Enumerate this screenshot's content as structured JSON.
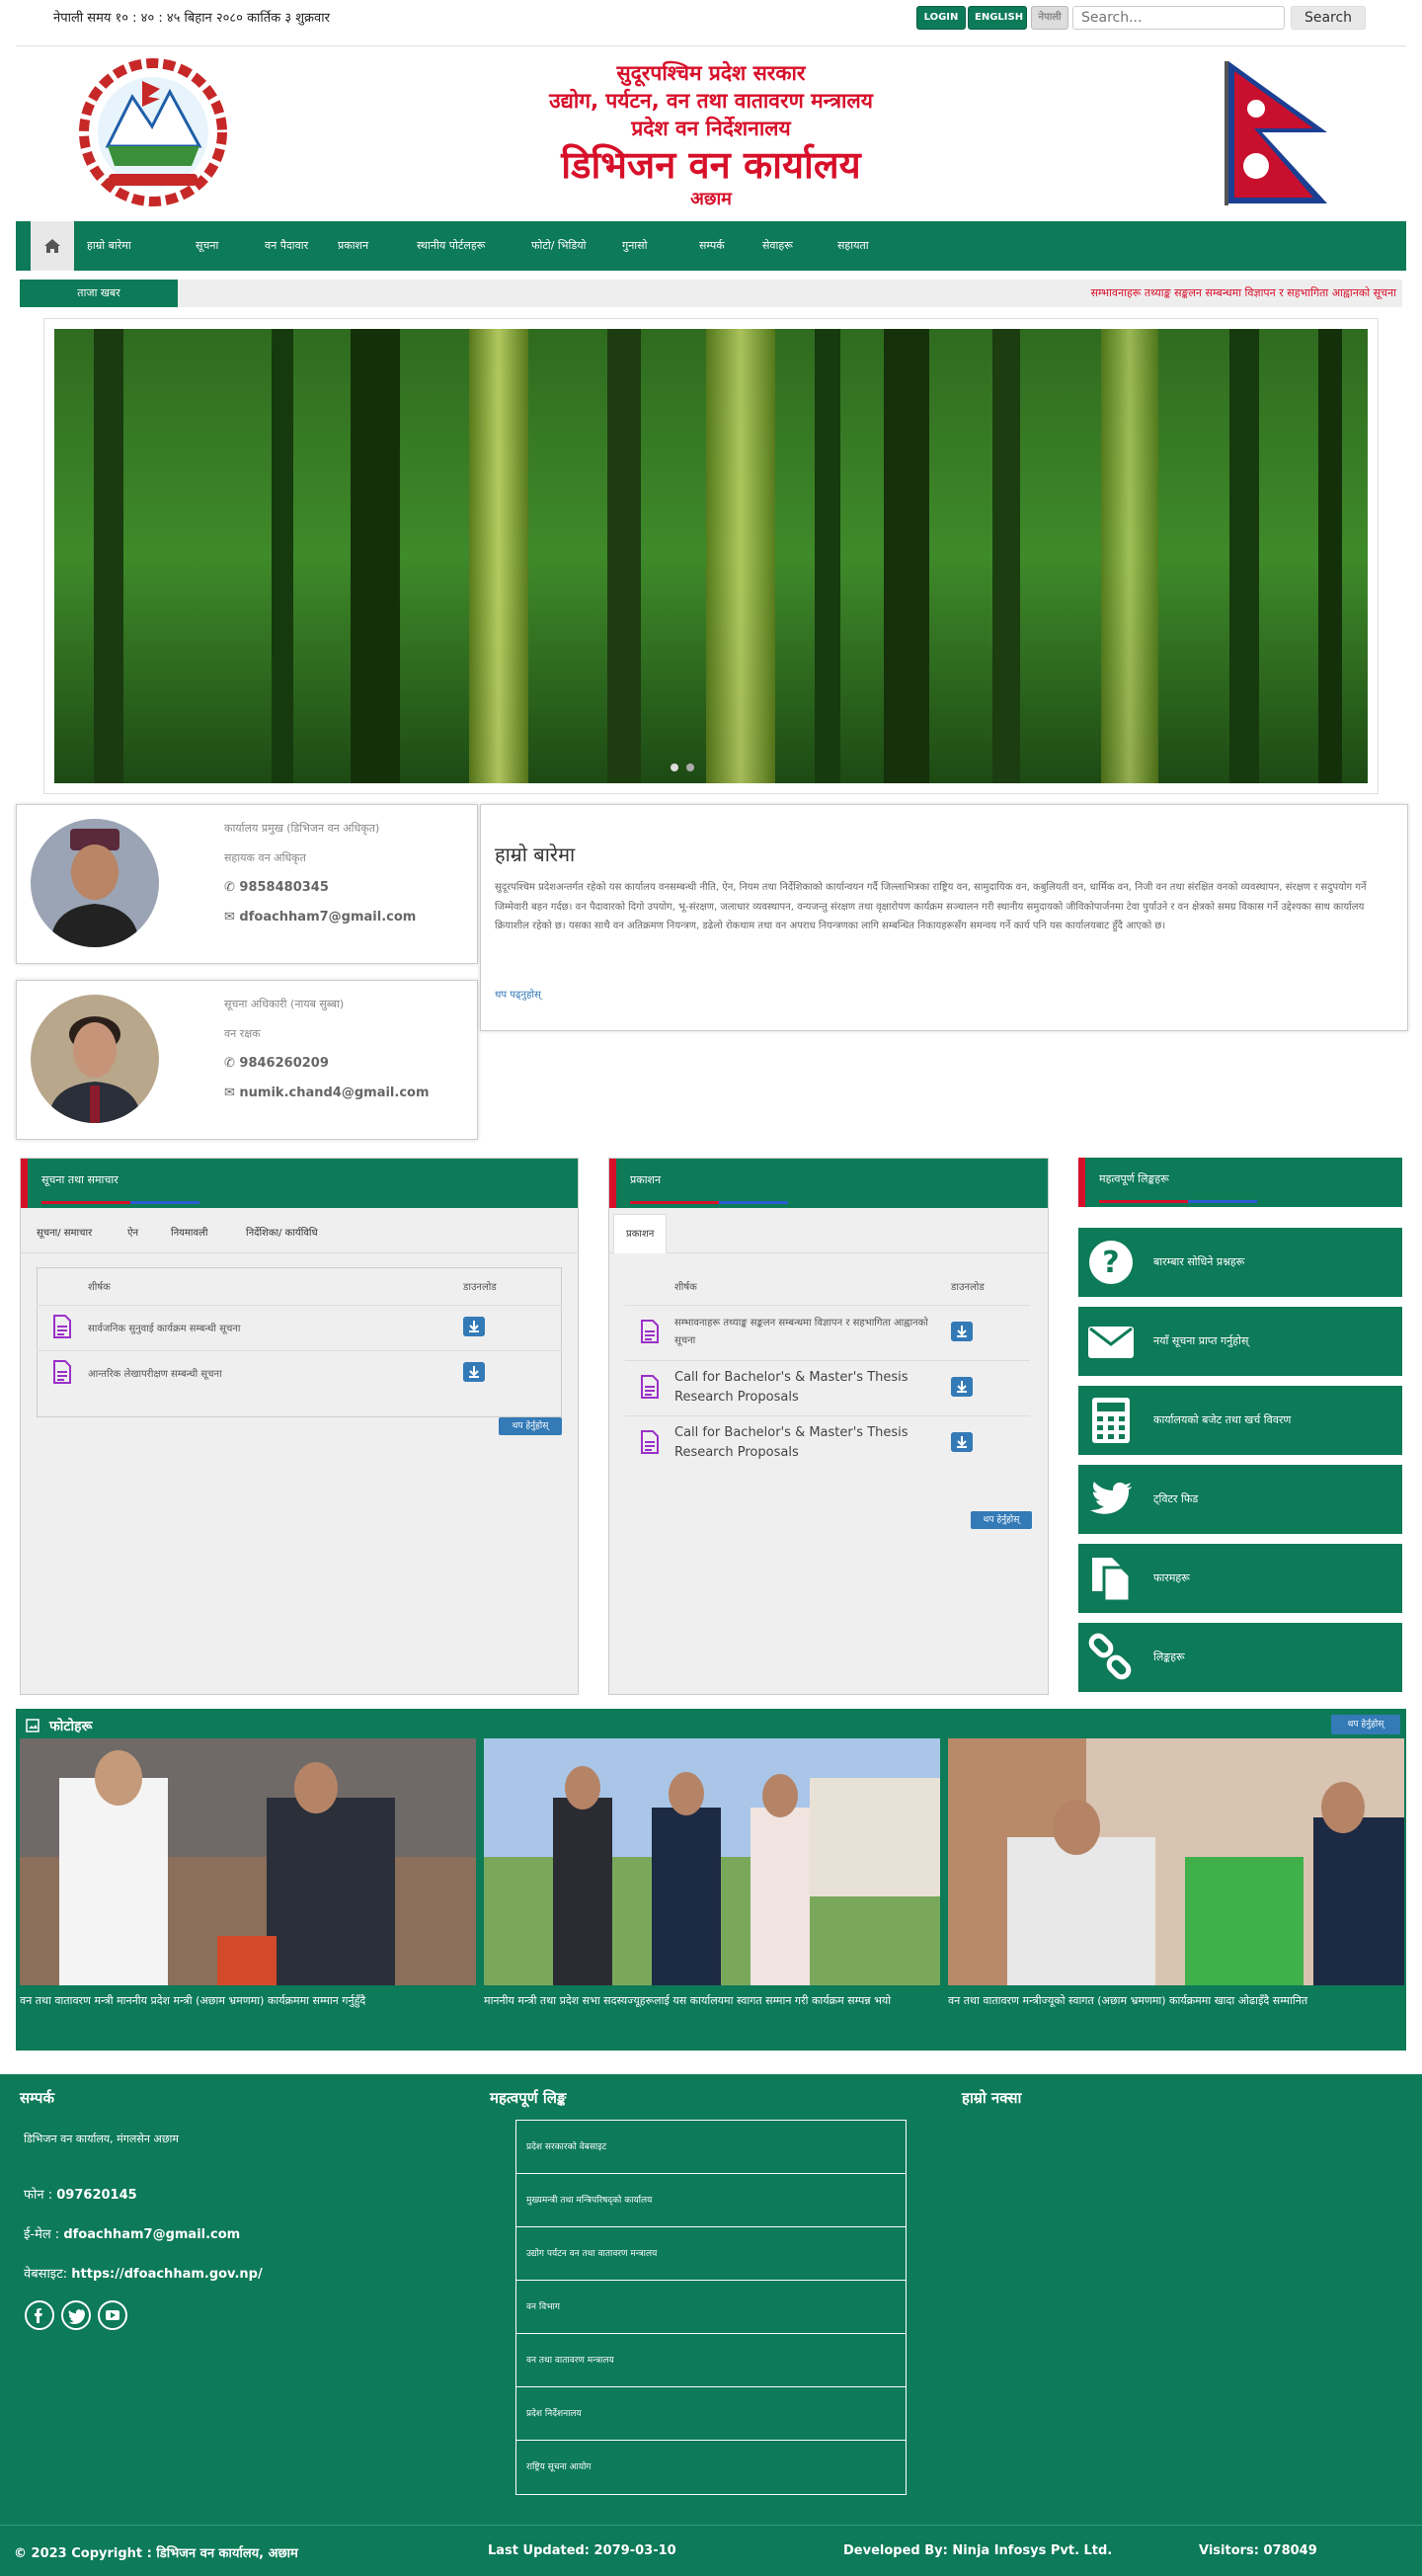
{
  "topbar": {
    "time_label": "नेपाली समय १० : ४० : ४५ बिहान   २०८० कार्तिक ३ शुक्रवार",
    "login": "LOGIN",
    "english": "ENGLISH",
    "nepali": "नेपाली",
    "search_placeholder": "Search...",
    "search_button": "Search"
  },
  "header": {
    "line1": "सुदूरपश्चिम प्रदेश सरकार",
    "line2": "उद्योग, पर्यटन, वन तथा वातावरण मन्त्रालय",
    "line3": "प्रदेश वन निर्देशनालय",
    "line4": "डिभिजन वन कार्यालय",
    "line5": "अछाम"
  },
  "nav": {
    "items": [
      "हाम्रो बारेमा",
      "सूचना",
      "वन पैदावार",
      "प्रकाशन",
      "स्थानीय पोर्टलहरू",
      "फोटो/ भिडियो",
      "गुनासो",
      "सम्पर्क",
      "सेवाहरू",
      "सहायता"
    ]
  },
  "ticker": {
    "label": "ताजा खबर",
    "message": "सम्भावनाहरू तथ्याङ्क सङ्कलन सम्बन्धमा विज्ञापन र सहभागिता आह्वानको सूचना"
  },
  "staff": [
    {
      "name": "कार्यालय प्रमुख (डिभिजन वन अधिकृत)",
      "role": "सहायक वन अधिकृत",
      "phone": "9858480345",
      "email": "dfoachham7@gmail.com"
    },
    {
      "name": "सूचना अधिकारी (नायब सुब्बा)",
      "role": "वन रक्षक",
      "phone": "9846260209",
      "email": "numik.chand4@gmail.com"
    }
  ],
  "about": {
    "title": "हाम्रो बारेमा",
    "text": "सुदूरपश्चिम प्रदेशअन्तर्गत रहेको यस कार्यालय वनसम्बन्धी नीति, ऐन, नियम तथा निर्देशिकाको कार्यान्वयन गर्दै जिल्लाभित्रका राष्ट्रिय वन, सामुदायिक वन, कबुलियती वन, धार्मिक वन, निजी वन तथा संरक्षित वनको व्यवस्थापन, संरक्षण र सदुपयोग गर्ने जिम्मेवारी बहन गर्दछ। वन पैदावारको दिगो उपयोग, भू-संरक्षण, जलाधार व्यवस्थापन, वन्यजन्तु संरक्षण तथा वृक्षारोपण कार्यक्रम सञ्चालन गरी स्थानीय समुदायको जीविकोपार्जनमा टेवा पुर्याउने र वन क्षेत्रको समग्र विकास गर्ने उद्देश्यका साथ कार्यालय क्रियाशील रहेको छ। यसका साथै वन अतिक्रमण नियन्त्रण, डढेलो रोकथाम तथा वन अपराध नियन्त्रणका लागि सम्बन्धित निकायहरूसँग समन्वय गर्ने कार्य पनि यस कार्यालयबाट हुँदै आएको छ।",
    "more": "थप पढ्नुहोस्"
  },
  "notices_panel": {
    "title": "सूचना तथा समाचार",
    "tabs": [
      "सूचना/ समाचार",
      "ऐन",
      "नियमावली",
      "निर्देशिका/ कार्यविधि"
    ],
    "col_title": "शीर्षक",
    "col_download": "डाउनलोड",
    "rows": [
      "सार्वजनिक सुनुवाई कार्यक्रम सम्बन्धी सूचना",
      "आन्तरिक लेखापरीक्षण सम्बन्धी सूचना"
    ],
    "more": "थप हेर्नुहोस्"
  },
  "publications_panel": {
    "title": "प्रकाशन",
    "tabs": [
      "प्रकाशन"
    ],
    "col_title": "शीर्षक",
    "col_download": "डाउनलोड",
    "rows": [
      "सम्भावनाहरू तथ्याङ्क सङ्कलन सम्बन्धमा विज्ञापन र सहभागिता आह्वानको सूचना",
      "Call for Bachelor's & Master's Thesis Research Proposals",
      "Call for Bachelor's & Master's Thesis Research Proposals"
    ],
    "more": "थप हेर्नुहोस्"
  },
  "quick_links": {
    "title": "महत्वपूर्ण लिङ्कहरू",
    "items": [
      "बारम्बार सोधिने प्रश्नहरू",
      "नयाँ सूचना प्राप्त गर्नुहोस्",
      "कार्यालयको बजेट तथा खर्च विवरण",
      "ट्विटर फिड",
      "फारमहरू",
      "लिङ्कहरू"
    ],
    "icons": [
      "question-icon",
      "envelope-icon",
      "calculator-icon",
      "twitter-icon",
      "copy-icon",
      "link-icon"
    ]
  },
  "gallery": {
    "title": "फोटोहरू",
    "more": "थप हेर्नुहोस्",
    "captions": [
      "वन तथा वातावरण मन्त्री माननीय प्रदेश मन्त्री (अछाम भ्रमणमा) कार्यक्रममा सम्मान गर्नुहुँदै",
      "माननीय मन्त्री तथा प्रदेश सभा सदस्यज्यूहरूलाई यस कार्यालयमा स्वागत सम्मान गरी कार्यक्रम सम्पन्न भयो",
      "वन तथा वातावरण मन्त्रीज्यूको स्वागत (अछाम भ्रमणमा) कार्यक्रममा खादा ओढाइँदै सम्मानित"
    ]
  },
  "footer": {
    "contact_title": "सम्पर्क",
    "address": "डिभिजन वन कार्यालय, मंगलसेन अछाम",
    "phone_label": "फोन",
    "phone": "097620145",
    "email_label": "ई-मेल",
    "email": "dfoachham7@gmail.com",
    "website_label": "वेबसाइट",
    "website": "https://dfoachham.gov.np/",
    "links_title": "महत्वपूर्ण लिङ्क",
    "links": [
      "प्रदेश सरकारको वेबसाइट",
      "मुख्यमन्त्री तथा मन्त्रिपरिषद्को कार्यालय",
      "उद्योग पर्यटन वन तथा वातावरण मन्त्रालय",
      "वन विभाग",
      "वन तथा वातावरण मन्त्रालय",
      "प्रदेश निर्देशनालय",
      "राष्ट्रिय सूचना आयोग"
    ],
    "map_title": "हाम्रो नक्सा",
    "copyright": "© 2023 Copyright : डिभिजन वन कार्यालय, अछाम",
    "updated": "Last Updated: 2079-03-10",
    "developer": "Developed By: Ninja Infosys Pvt. Ltd.",
    "visitors": "Visitors: 078049"
  },
  "colors": {
    "primary": "#0d7a58",
    "accent": "#d7102a",
    "link": "#337ab7"
  }
}
